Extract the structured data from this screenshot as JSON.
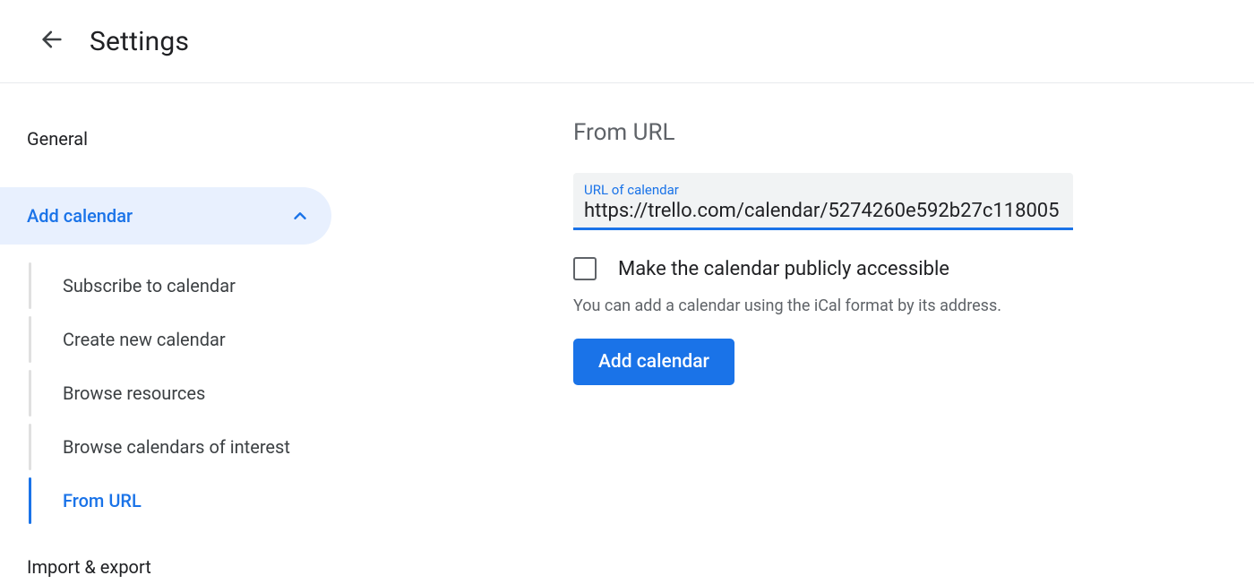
{
  "header": {
    "title": "Settings"
  },
  "sidebar": {
    "general": "General",
    "add_calendar": "Add calendar",
    "sub_items": [
      {
        "label": "Subscribe to calendar",
        "active": false
      },
      {
        "label": "Create new calendar",
        "active": false
      },
      {
        "label": "Browse resources",
        "active": false
      },
      {
        "label": "Browse calendars of interest",
        "active": false
      },
      {
        "label": "From URL",
        "active": true
      }
    ],
    "import_export": "Import & export"
  },
  "main": {
    "section_title": "From URL",
    "url_field_label": "URL of calendar",
    "url_value": "https://trello.com/calendar/5274260e592b27c118005",
    "checkbox_label": "Make the calendar publicly accessible",
    "helper_text": "You can add a calendar using the iCal format by its address.",
    "add_button": "Add calendar"
  }
}
